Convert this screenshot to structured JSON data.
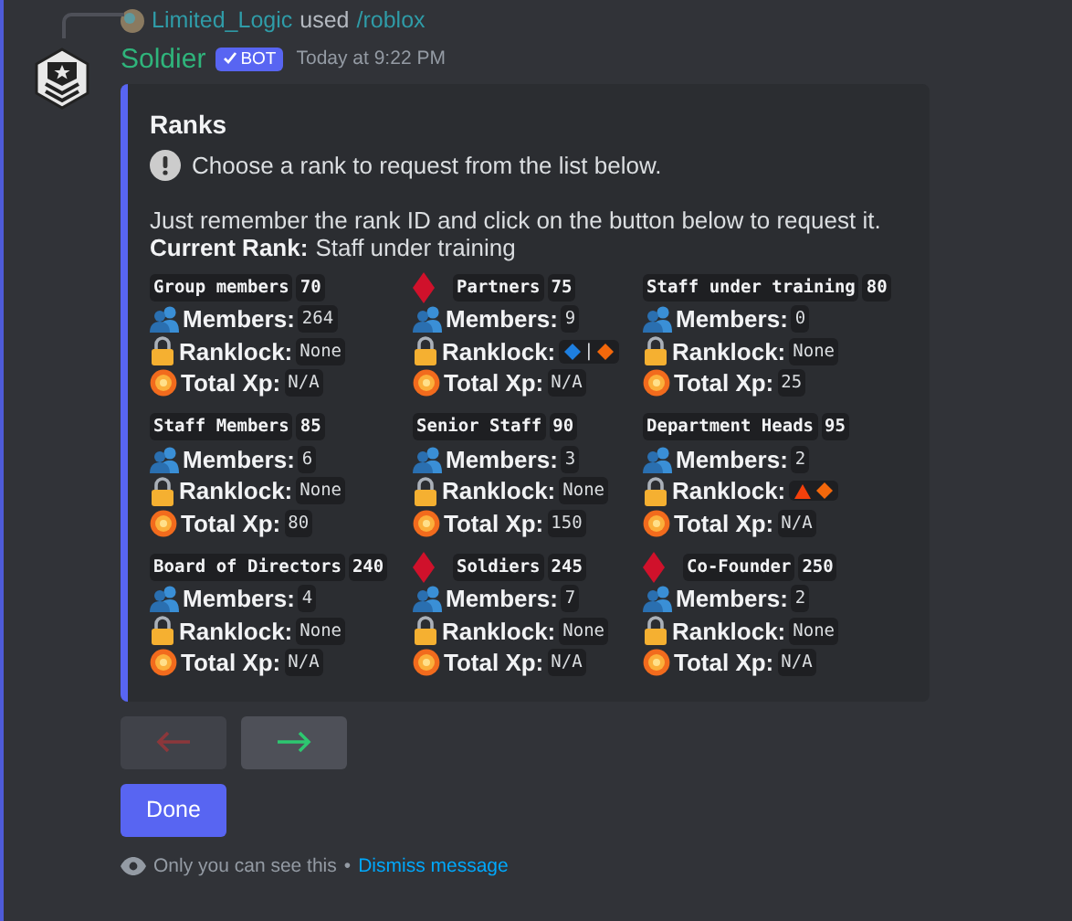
{
  "reply": {
    "user": "Limited_Logic",
    "verb": "used",
    "command": "/roblox"
  },
  "message": {
    "author": "Soldier",
    "badge": "BOT",
    "time": "Today at 9:22 PM"
  },
  "embed": {
    "title": "Ranks",
    "notice": "Choose a rank to request from the list below.",
    "description": "Just remember the rank ID and click on the button below to request it.",
    "current_label": "Current Rank:",
    "current_value": "Staff under training",
    "ranks": [
      {
        "name": "Group members",
        "id": "70",
        "marked": false,
        "fields": [
          {
            "kind": "members",
            "label": "Members:",
            "value": "264"
          },
          {
            "kind": "ranklock",
            "label": "Ranklock:",
            "value": "None"
          },
          {
            "kind": "xp",
            "label": "Total Xp:",
            "value": "N/A"
          }
        ]
      },
      {
        "name": "Partners",
        "id": "75",
        "marked": true,
        "fields": [
          {
            "kind": "members",
            "label": "Members:",
            "value": "9"
          },
          {
            "kind": "ranklock",
            "label": "Ranklock:",
            "symbols": [
              {
                "kind": "diamond",
                "color": "#1e7fe0"
              },
              {
                "kind": "text",
                "text": "|"
              },
              {
                "kind": "diamond",
                "color": "#f4680b"
              }
            ]
          },
          {
            "kind": "xp",
            "label": "Total Xp:",
            "value": "N/A"
          }
        ]
      },
      {
        "name": "Staff under training",
        "id": "80",
        "marked": false,
        "fields": [
          {
            "kind": "members",
            "label": "Members:",
            "value": "0"
          },
          {
            "kind": "ranklock",
            "label": "Ranklock:",
            "value": "None"
          },
          {
            "kind": "xp",
            "label": "Total Xp:",
            "value": "25"
          }
        ]
      },
      {
        "name": "Staff Members",
        "id": "85",
        "marked": false,
        "fields": [
          {
            "kind": "members",
            "label": "Members:",
            "value": "6"
          },
          {
            "kind": "ranklock",
            "label": "Ranklock:",
            "value": "None"
          },
          {
            "kind": "xp",
            "label": "Total Xp:",
            "value": "80"
          }
        ]
      },
      {
        "name": "Senior Staff",
        "id": "90",
        "marked": false,
        "fields": [
          {
            "kind": "members",
            "label": "Members:",
            "value": "3"
          },
          {
            "kind": "ranklock",
            "label": "Ranklock:",
            "value": "None"
          },
          {
            "kind": "xp",
            "label": "Total Xp:",
            "value": "150"
          }
        ]
      },
      {
        "name": "Department Heads",
        "id": "95",
        "marked": false,
        "fields": [
          {
            "kind": "members",
            "label": "Members:",
            "value": "2"
          },
          {
            "kind": "ranklock",
            "label": "Ranklock:",
            "symbols": [
              {
                "kind": "triangle",
                "color": "#f4400b"
              },
              {
                "kind": "diamond",
                "color": "#f4680b"
              }
            ]
          },
          {
            "kind": "xp",
            "label": "Total Xp:",
            "value": "N/A"
          }
        ]
      },
      {
        "name": "Board of Directors",
        "id": "240",
        "marked": false,
        "fields": [
          {
            "kind": "members",
            "label": "Members:",
            "value": "4"
          },
          {
            "kind": "ranklock",
            "label": "Ranklock:",
            "value": "None"
          },
          {
            "kind": "xp",
            "label": "Total Xp:",
            "value": "N/A"
          }
        ]
      },
      {
        "name": "Soldiers",
        "id": "245",
        "marked": true,
        "fields": [
          {
            "kind": "members",
            "label": "Members:",
            "value": "7"
          },
          {
            "kind": "ranklock",
            "label": "Ranklock:",
            "value": "None"
          },
          {
            "kind": "xp",
            "label": "Total Xp:",
            "value": "N/A"
          }
        ]
      },
      {
        "name": "Co-Founder",
        "id": "250",
        "marked": true,
        "fields": [
          {
            "kind": "members",
            "label": "Members:",
            "value": "2"
          },
          {
            "kind": "ranklock",
            "label": "Ranklock:",
            "value": "None"
          },
          {
            "kind": "xp",
            "label": "Total Xp:",
            "value": "N/A"
          }
        ]
      }
    ]
  },
  "nav_buttons": [
    {
      "kind": "left",
      "disabled": true
    },
    {
      "kind": "right",
      "disabled": false
    }
  ],
  "done_button": "Done",
  "footer": {
    "text": "Only you can see this",
    "separator": "•",
    "link": "Dismiss message"
  }
}
